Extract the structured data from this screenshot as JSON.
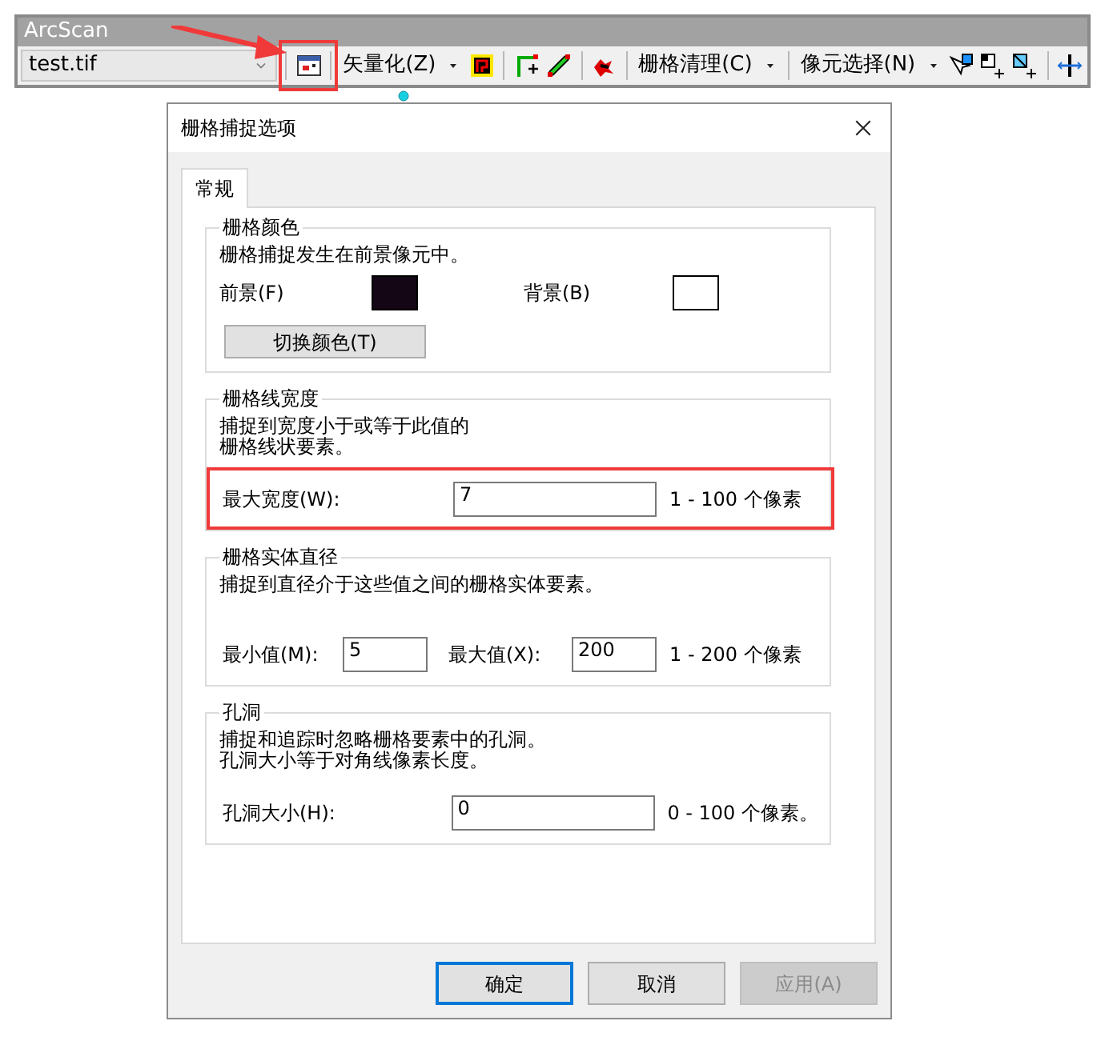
{
  "toolbar": {
    "title": "ArcScan",
    "layer": "test.tif",
    "settings_highlighted": true,
    "menus": [
      "矢量化(Z)",
      "栅格清理(C)",
      "像元选择(N)"
    ]
  },
  "dialog": {
    "title": "栅格捕捉选项",
    "tabs": [
      {
        "label": "常规",
        "selected": true
      }
    ],
    "groups": [
      {
        "kind": "colors",
        "title": "栅格颜色",
        "description": [
          "栅格捕捉发生在前景像元中。"
        ],
        "swatches": [
          {
            "label": "前景(F)",
            "color": "#140614"
          },
          {
            "label": "背景(B)",
            "color": "#ffffff"
          }
        ],
        "button": "切换颜色(T)"
      },
      {
        "kind": "fields",
        "title": "栅格线宽度",
        "description": [
          "捕捉到宽度小于或等于此值的",
          "栅格线状要素。"
        ],
        "fields": [
          {
            "label": "最大宽度(W):",
            "value": "7"
          }
        ],
        "range": "1 - 100 个像素",
        "highlighted": true
      },
      {
        "kind": "fields",
        "title": "栅格实体直径",
        "description": [
          "捕捉到直径介于这些值之间的栅格实体要素。"
        ],
        "fields": [
          {
            "label": "最小值(M):",
            "value": "5"
          },
          {
            "label": "最大值(X):",
            "value": "200"
          }
        ],
        "range": "1 - 200 个像素",
        "highlighted": false
      },
      {
        "kind": "fields",
        "title": "孔洞",
        "description": [
          "捕捉和追踪时忽略栅格要素中的孔洞。",
          "孔洞大小等于对角线像素长度。"
        ],
        "fields": [
          {
            "label": "孔洞大小(H):",
            "value": "0"
          }
        ],
        "range": "0 - 100 个像素。",
        "highlighted": false
      }
    ],
    "buttons": [
      {
        "label": "确定",
        "default": true,
        "disabled": false
      },
      {
        "label": "取消",
        "default": false,
        "disabled": false
      },
      {
        "label": "应用(A)",
        "default": false,
        "disabled": true
      }
    ]
  }
}
